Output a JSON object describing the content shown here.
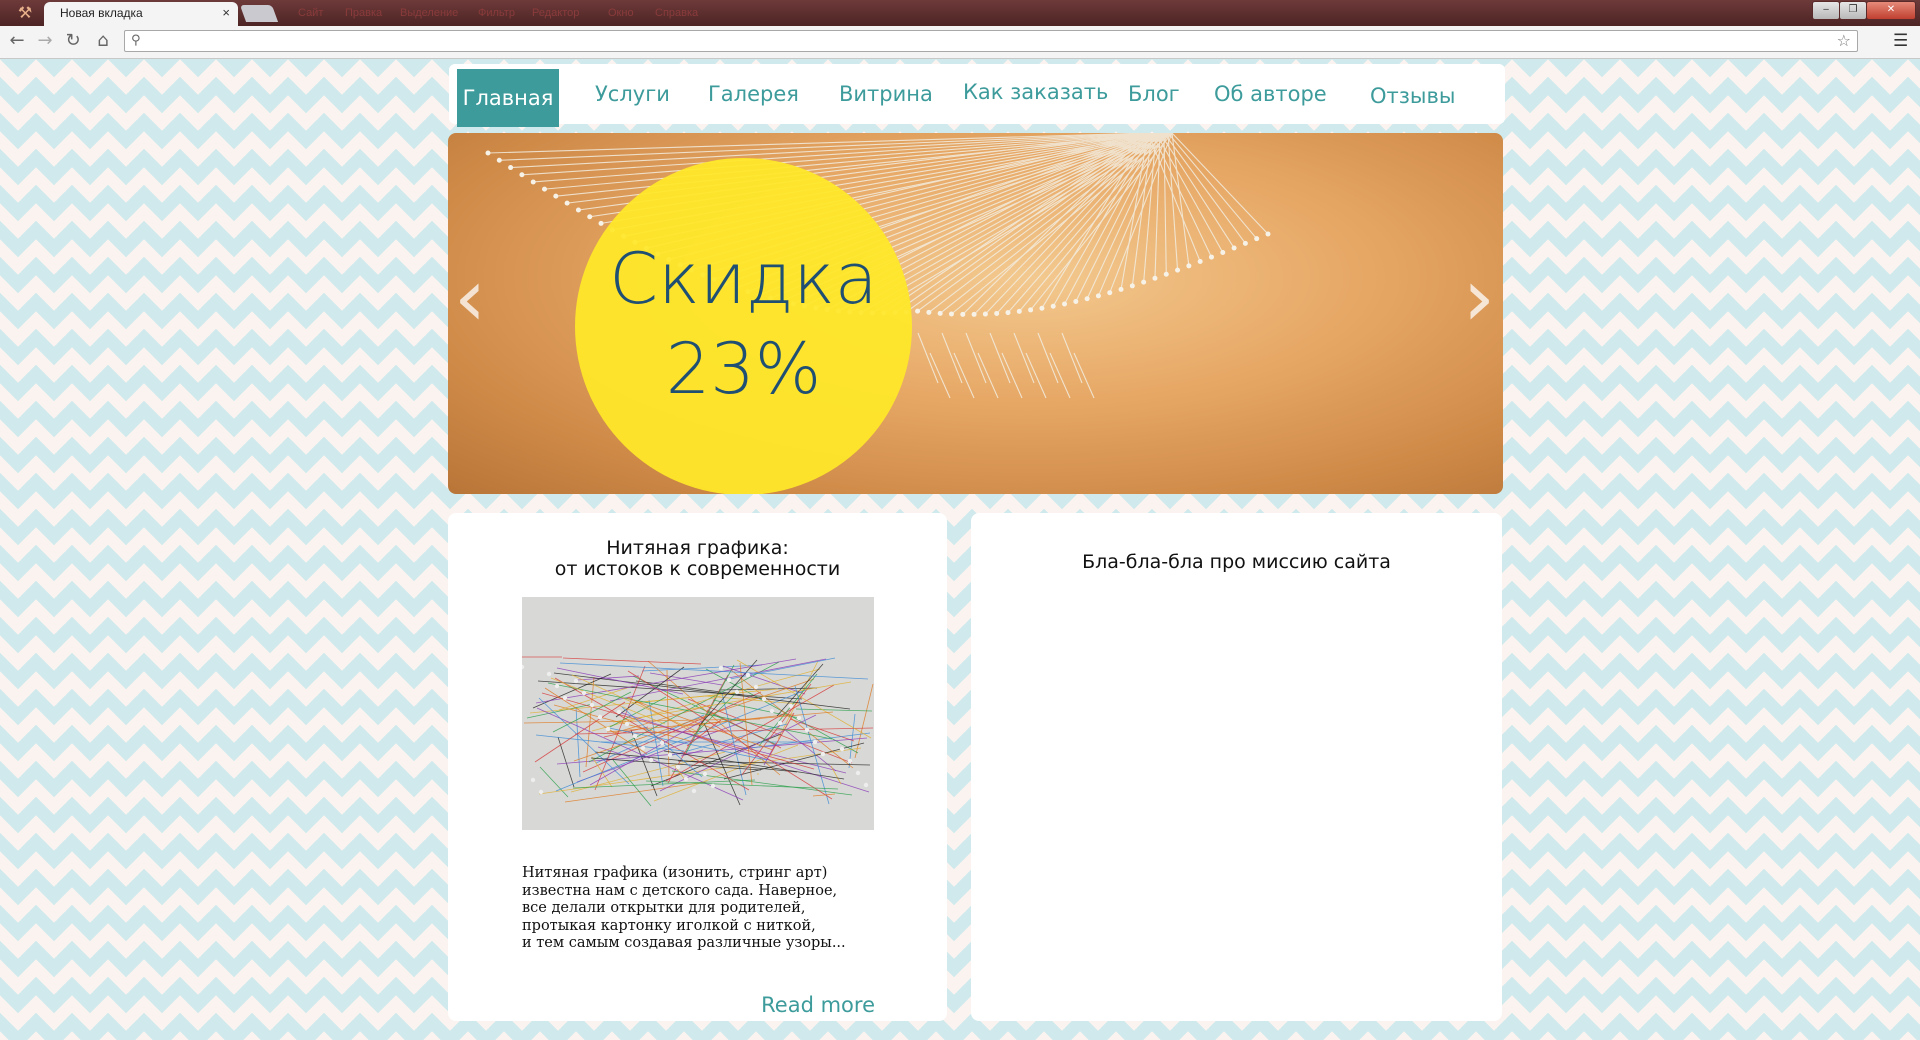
{
  "browser": {
    "tab_title": "Новая вкладка",
    "tab_close": "×",
    "menu_bar": [
      "Сайт",
      "Правка",
      "Выделение",
      "Фильтр",
      "Редактор",
      "Окно",
      "Справка"
    ],
    "address_value": "",
    "window_controls": [
      "‒",
      "❐",
      "✕"
    ]
  },
  "nav": {
    "items": [
      "Главная",
      "Услуги",
      "Галерея",
      "Витрина",
      "Как заказать",
      "Блог",
      "Об авторе",
      "Отзывы"
    ],
    "active_index": 0,
    "active_color": "#3d9b9b"
  },
  "slider": {
    "promo_line1": "Скидка",
    "promo_line2": "23%",
    "prev_arrow": "‹",
    "next_arrow": "›",
    "circle_color": "#ffe828",
    "text_color": "#1f4f73"
  },
  "article": {
    "title_line1": "Нитяная графика:",
    "title_line2": "от истоков к современности",
    "body": "Нитяная графика (изонить, стринг арт)\nизвестна нам с детского сада. Наверное,\nвсе делали открытки для родителей,\nпротыкая картонку иголкой с ниткой,\nи тем самым создавая различные узоры...",
    "read_more": "Read more"
  },
  "mission": {
    "title": "Бла-бла-бла про миссию сайта"
  }
}
